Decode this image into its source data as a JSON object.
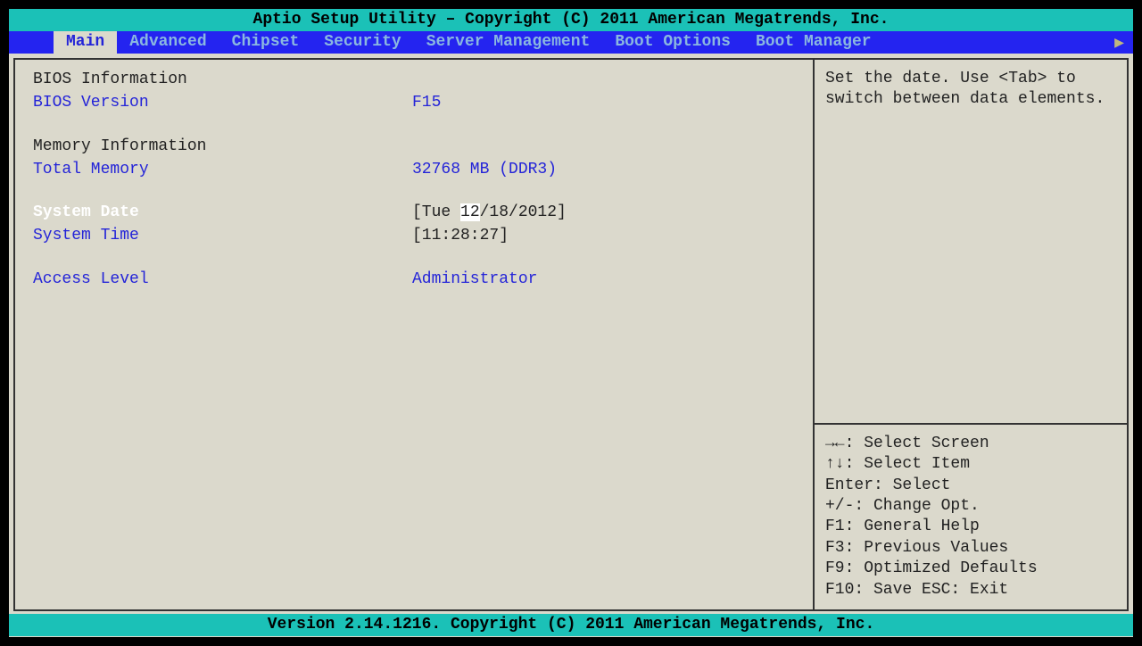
{
  "header": {
    "title": "Aptio Setup Utility – Copyright (C) 2011 American Megatrends, Inc."
  },
  "tabs": {
    "items": [
      {
        "label": "Main",
        "active": true
      },
      {
        "label": "Advanced",
        "active": false
      },
      {
        "label": "Chipset",
        "active": false
      },
      {
        "label": "Security",
        "active": false
      },
      {
        "label": "Server Management",
        "active": false
      },
      {
        "label": "Boot Options",
        "active": false
      },
      {
        "label": "Boot Manager",
        "active": false
      }
    ],
    "arrow": "▶"
  },
  "main": {
    "bios_heading": "BIOS Information",
    "bios_version_label": "BIOS Version",
    "bios_version_value": "F15",
    "mem_heading": "Memory Information",
    "total_mem_label": "Total Memory",
    "total_mem_value": "32768 MB (DDR3)",
    "sys_date_label": "System Date",
    "sys_date_prefix": "[Tue ",
    "sys_date_selected": "12",
    "sys_date_suffix": "/18/2012]",
    "sys_time_label": "System Time",
    "sys_time_value": "[11:28:27]",
    "access_label": "Access Level",
    "access_value": "Administrator"
  },
  "help": {
    "text": "Set the date. Use <Tab> to switch between data elements."
  },
  "nav": {
    "l1": "→←: Select Screen",
    "l2": "↑↓: Select Item",
    "l3": "Enter: Select",
    "l4": "+/-: Change Opt.",
    "l5": "F1: General Help",
    "l6": "F3: Previous Values",
    "l7": "F9: Optimized Defaults",
    "l8": "F10: Save  ESC: Exit"
  },
  "footer": {
    "text": "Version 2.14.1216. Copyright (C) 2011 American Megatrends, Inc."
  }
}
